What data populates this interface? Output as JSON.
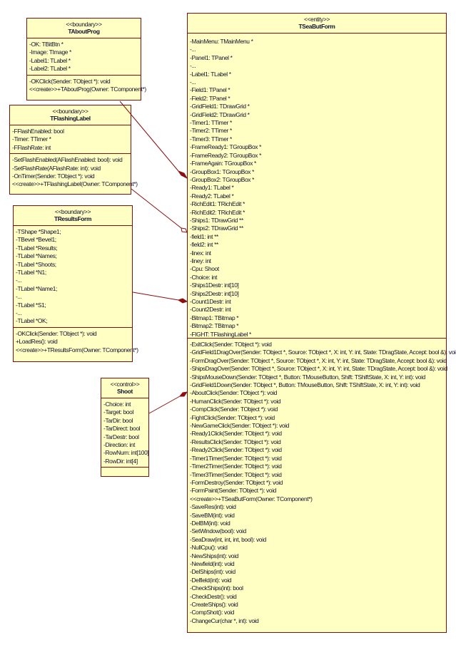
{
  "classes": {
    "aboutprog": {
      "stereotype": "<<boundary>>",
      "name": "TAboutProg",
      "attributes": [
        "-OK: TBitBtn *",
        "-Image: TImage *",
        "-Label1: TLabel *",
        "-Label2: TLabel *"
      ],
      "operations": [
        "-OKClick(Sender: TObject *): void",
        "<<create>>+TAboutProg(Owner: TComponent*)"
      ]
    },
    "flashinglabel": {
      "stereotype": "<<boundary>>",
      "name": "TFlashingLabel",
      "attributes": [
        "-FFlashEnabled: bool",
        "-Timer: TTimer *",
        "-FFlashRate: int"
      ],
      "operations": [
        "-SetFlashEnabled(AFlashEnabled: bool): void",
        "-SetFlashRate(AFlashRate: int): void",
        "-OnTimer(Sender: TObject *): void",
        "<<create>>+TFlashingLabel(Owner: TComponent*)"
      ]
    },
    "resultsform": {
      "stereotype": "<<boundary>>",
      "name": "TResultsForm",
      "attributes": [
        "-TShape *Shape1;",
        "-TBevel *Bevel1;",
        "-TLabel *Results;",
        "-TLabel *Names;",
        "-TLabel *Shoots;",
        "-TLabel *N1;",
        "-...",
        "-TLabel *Name1;",
        "-...",
        "-TLabel *S1;",
        "-...",
        "-TLabel *OK;"
      ],
      "operations": [
        "-OKClick(Sender: TObject *): void",
        "+LoadRes(): void",
        "<<create>>+TResultsForm(Owner: TComponent*)"
      ]
    },
    "shoot": {
      "stereotype": "<<control>>",
      "name": "Shoot",
      "attributes": [
        "-Choice: int",
        "-Target: bool",
        "-TarDir: bool",
        "-TarDirect: bool",
        "-TarDestr: bool",
        "-Direction: int",
        "-RowNum: int[100]",
        "-RowDir: int[4]"
      ],
      "operations": []
    },
    "seabutform": {
      "stereotype": "<<entity>>",
      "name": "TSeaButForm",
      "attributes": [
        "-MainMenu: TMainMenu *",
        "-...",
        "-Panel1: TPanel *",
        "-...",
        "-Label1: TLabel *",
        "-...",
        "-Field1: TPanel *",
        "-Field2: TPanel *",
        "-GridField1: TDrawGrid *",
        "-GridField2: TDrawGrid *",
        "-Timer1: TTimer *",
        "-Timer2: TTimer *",
        "-Timer3: TTimer *",
        "-FrameReady1: TGroupBox *",
        "-FrameReady2: TGroupBox *",
        "-FrameAgain: TGroupBox *",
        "-GroupBox1: TGroupBox *",
        "-GroupBox2: TGroupBox *",
        "-Ready1: TLabel *",
        "-Ready2: TLabel *",
        "-RichEdit1: TRichEdit *",
        "-RichEdit2: TRichEdit *",
        "-Ships1: TDrawGrid **",
        "-Ships2: TDrawGrid **",
        "-field1: int **",
        "-field2: int **",
        "-linex: int",
        "-liney: int",
        "-Cpu: Shoot",
        "-Choice: int",
        "-Ships1Destr: int[10]",
        "-Ships2Destr: int[10]",
        "-Count1Destr: int",
        "-Count2Destr: int",
        "-Bitmap1: TBitmap *",
        "-Bitmap2: TBitmap *",
        "-FIGHT: TFlashingLabel *"
      ],
      "operations": [
        "-ExitClick(Sender: TObject *): void",
        "-GridField1DragOver(Sender: TObject *, Source: TObject *, X: int, Y: int, State: TDragState, Accept: bool &): void",
        "-FormDragOver(Sender: TObject *, Source: TObject *, X: int, Y: int, State: TDragState, Accept: bool &): void",
        "-ShipsDragOver(Sender: TObject *, Source: TObject *, X: int, Y: int, State: TDragState, Accept: bool &): void",
        "-ShipsMouseDown(Sender: TObject *, Button: TMouseButton, Shift: TShiftState, X: int, Y: int): void",
        "-GridField1Down(Sender: TObject *, Button: TMouseButton, Shift: TShiftState, X: int, Y: int): void",
        "-AboutClick(Sender: TObject *): void",
        "-HumanClick(Sender: TObject *): void",
        "-CompClick(Sender: TObject *): void",
        "-FightClick(Sender: TObject *): void",
        "-NewGameClick(Sender: TObject *): void",
        "-Ready1Click(Sender: TObject *): void",
        "-ResultsClick(Sender: TObject *): void",
        "-Ready2Click(Sender: TObject *): void",
        "-Timer1Timer(Sender: TObject *): void",
        "-Timer2Timer(Sender: TObject *): void",
        "-Timer3Timer(Sender: TObject *): void",
        "-FormDestroy(Sender: TObject *): void",
        "-FormPaint(Sender: TObject *): void",
        "<<create>>+TSeaButForm(Owner: TComponent*)",
        "-SaveRes(int): void",
        "-SaveBM(int): void",
        "-DelBM(int): void",
        "-SetWindow(bool): void",
        "-SeaDraw(int, int, int, bool): void",
        "-NullCpu(): void",
        "-NewShips(int): void",
        "-Newfield(int): void",
        "-DelShips(int): void",
        "-Delfield(int): void",
        "-CheckShips(int): bool",
        "-CheckDestr(): void",
        "-CreateShips(): void",
        "-CompShot(): void",
        "-ChangeCur(char *, int): void"
      ]
    }
  },
  "colors": {
    "fill": "#ffffc4",
    "border": "#7a1010",
    "link": "#8b1010"
  }
}
